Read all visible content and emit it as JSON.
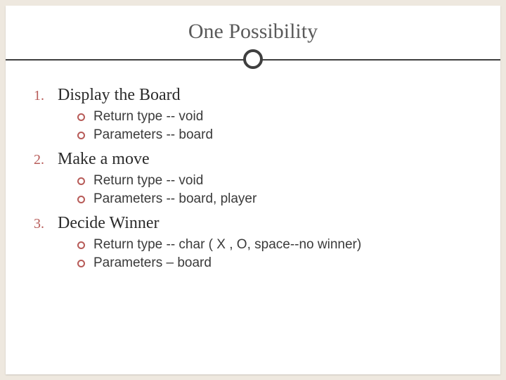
{
  "title": "One Possibility",
  "items": [
    {
      "num": "1.",
      "heading": "Display the Board",
      "subs": [
        "Return type -- void",
        "Parameters -- board"
      ]
    },
    {
      "num": "2.",
      "heading": "Make a move",
      "subs": [
        "Return type --  void",
        "Parameters --  board, player"
      ]
    },
    {
      "num": "3.",
      "heading": "Decide Winner",
      "subs": [
        "Return type  -- char ( X , O,  space--no winner)",
        "Parameters – board"
      ]
    }
  ]
}
